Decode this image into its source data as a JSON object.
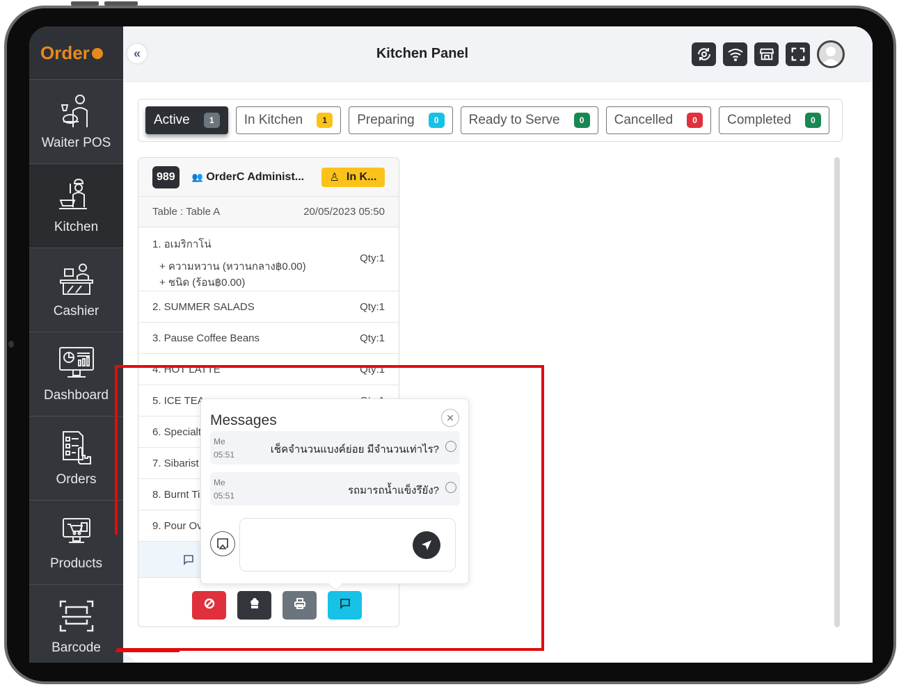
{
  "app": {
    "logo_text": "Order"
  },
  "sidebar": {
    "items": [
      {
        "label": "Waiter POS",
        "icon": "waiter-icon"
      },
      {
        "label": "Kitchen",
        "icon": "chef-icon",
        "active": true
      },
      {
        "label": "Cashier",
        "icon": "cashier-icon"
      },
      {
        "label": "Dashboard",
        "icon": "dashboard-icon"
      },
      {
        "label": "Orders",
        "icon": "orders-icon"
      },
      {
        "label": "Products",
        "icon": "products-icon"
      },
      {
        "label": "Barcode",
        "icon": "barcode-scan-icon"
      }
    ]
  },
  "header": {
    "title": "Kitchen Panel",
    "collapse_glyph": "«",
    "icons": [
      "sync-icon",
      "wifi-icon",
      "store-icon",
      "fullscreen-icon",
      "user-avatar"
    ]
  },
  "tabs": [
    {
      "label": "Active",
      "count": "1",
      "color": "#6c757d",
      "active": true
    },
    {
      "label": "In Kitchen",
      "count": "1",
      "color": "#fbc21a",
      "text_color": "#222"
    },
    {
      "label": "Preparing",
      "count": "0",
      "color": "#17c1e8"
    },
    {
      "label": "Ready to Serve",
      "count": "0",
      "color": "#198754"
    },
    {
      "label": "Cancelled",
      "count": "0",
      "color": "#e0303b"
    },
    {
      "label": "Completed",
      "count": "0",
      "color": "#198754"
    }
  ],
  "order": {
    "number": "989",
    "created_by": "OrderC Administ...",
    "status": "In K...",
    "table": "Table : Table A",
    "datetime": "20/05/2023 05:50",
    "items": [
      {
        "name": "1. อเมริกาโน่",
        "mods": [
          "+ ความหวาน (หวานกลาง฿0.00)",
          "+ ชนิด (ร้อน฿0.00)"
        ],
        "qty": "Qty:1"
      },
      {
        "name": "2. SUMMER SALADS",
        "qty": "Qty:1"
      },
      {
        "name": "3. Pause Coffee Beans",
        "qty": "Qty:1"
      },
      {
        "name": "4. HOT LATTE",
        "qty": "Qty:1"
      },
      {
        "name": "5. ICE TEA",
        "qty": "Qty:1"
      },
      {
        "name": "6. Specialt",
        "qty": ""
      },
      {
        "name": "7. Sibarist",
        "qty": ""
      },
      {
        "name": "8. Burnt Ti",
        "qty": ""
      },
      {
        "name": "9. Pour Ov",
        "qty": ""
      }
    ],
    "actions": [
      {
        "name": "cancel-order-button",
        "icon": "ban-icon",
        "color": "#e0303b"
      },
      {
        "name": "send-to-kitchen-button",
        "icon": "chef-hat-icon",
        "color": "#33373c"
      },
      {
        "name": "print-button",
        "icon": "printer-icon",
        "color": "#6c757d"
      },
      {
        "name": "messages-button",
        "icon": "chat-icon",
        "color": "#17c1e8"
      }
    ]
  },
  "messages": {
    "title": "Messages",
    "close_glyph": "✕",
    "list": [
      {
        "sender": "Me",
        "time": "05:51",
        "text": "เช็คจำนวนแบงค์ย่อย มีจำนวนเท่าไร?"
      },
      {
        "sender": "Me",
        "time": "05:51",
        "text": "รถมารถน้ำแข็งรึยัง?"
      }
    ],
    "input_value": "",
    "input_placeholder": ""
  }
}
